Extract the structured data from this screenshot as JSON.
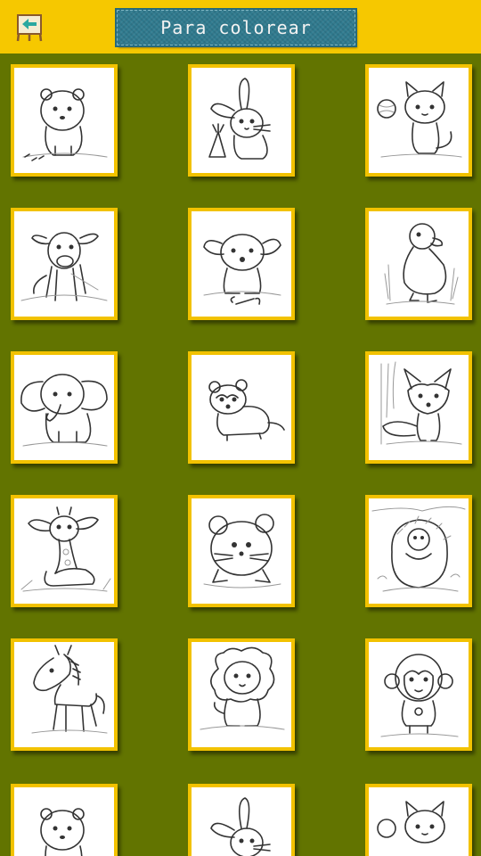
{
  "header": {
    "title": "Para colorear",
    "back_icon": "easel-back-arrow-icon",
    "accent": "#f6c800",
    "banner_color": "#2f7a8e"
  },
  "page": {
    "background": "#627400",
    "card_border": "#f2c200"
  },
  "drawings": [
    {
      "name": "bear"
    },
    {
      "name": "bunny"
    },
    {
      "name": "kitten"
    },
    {
      "name": "calf"
    },
    {
      "name": "puppy"
    },
    {
      "name": "duck"
    },
    {
      "name": "elephant"
    },
    {
      "name": "ferret"
    },
    {
      "name": "fox"
    },
    {
      "name": "giraffe"
    },
    {
      "name": "hamster"
    },
    {
      "name": "hedgehog"
    },
    {
      "name": "horse"
    },
    {
      "name": "lion"
    },
    {
      "name": "monkey"
    },
    {
      "name": "bear"
    },
    {
      "name": "bunny"
    },
    {
      "name": "kitten"
    }
  ]
}
